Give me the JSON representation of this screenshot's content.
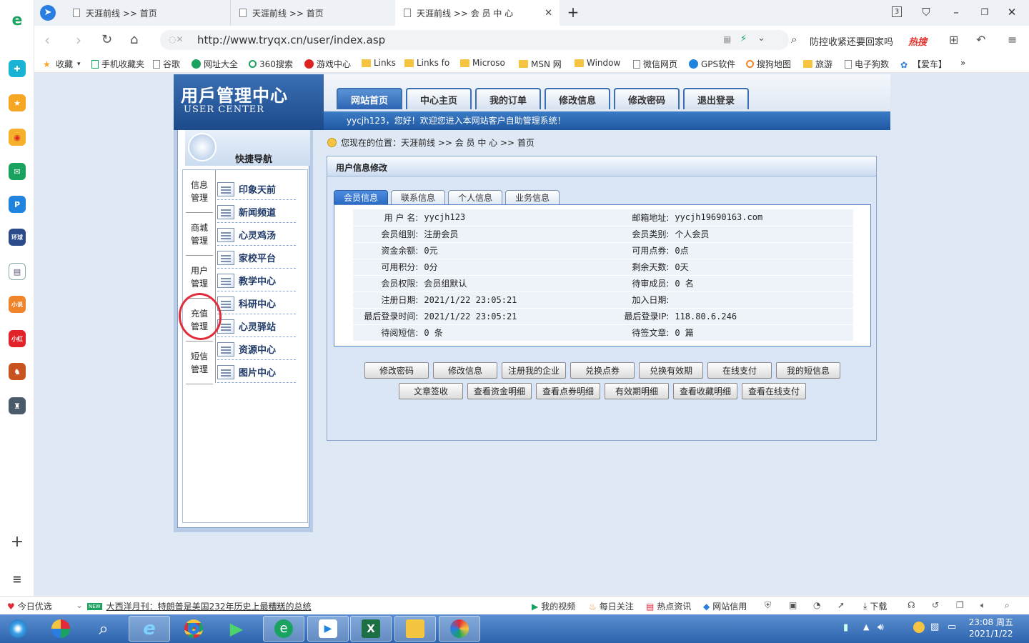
{
  "browser": {
    "tabs": [
      {
        "label": "天涯前线 >> 首页"
      },
      {
        "label": "天涯前线 >> 首页"
      },
      {
        "label": "天涯前线 >> 会 员 中 心"
      }
    ],
    "tab_count": "3",
    "url": "http://www.tryqx.cn/user/index.asp",
    "search_placeholder": "防控收紧还要回家吗",
    "search_hot": "热搜",
    "bookmarks": [
      "收藏",
      "手机收藏夹",
      "谷歌",
      "网址大全",
      "360搜索",
      "游戏中心",
      "Links",
      "Links fo",
      "Microso",
      "MSN 网",
      "Window",
      "微信网页",
      "GPS软件",
      "搜狗地图",
      "旅游",
      "电子狗数",
      "【爱车】",
      "»"
    ]
  },
  "site": {
    "logo_cn": "用戶管理中心",
    "logo_en": "USER CENTER",
    "nav": [
      "网站首页",
      "中心主页",
      "我的订单",
      "修改信息",
      "修改密码",
      "退出登录"
    ],
    "welcome": "yycjh123，您好！欢迎您进入本网站客户自助管理系统！",
    "quick_nav_title": "快捷导航",
    "categories": [
      "信息\n管理",
      "商城\n管理",
      "用户\n管理",
      "充值\n管理",
      "短信\n管理"
    ],
    "nav_items": [
      "印象天前",
      "新闻频道",
      "心灵鸡汤",
      "家校平台",
      "教学中心",
      "科研中心",
      "心灵驿站",
      "资源中心",
      "图片中心"
    ],
    "breadcrumb": "您现在的位置：天涯前线 >> 会 员 中 心 >> 首页",
    "panel_title": "用户信息修改",
    "sub_tabs": [
      "会员信息",
      "联系信息",
      "个人信息",
      "业务信息"
    ],
    "info_rows": [
      {
        "l1": "用 户 名:",
        "v1": "yycjh123",
        "l2": "邮箱地址:",
        "v2": "yycjh19690163.com"
      },
      {
        "l1": "会员组别:",
        "v1": "注册会员",
        "l2": "会员类别:",
        "v2": "个人会员"
      },
      {
        "l1": "资金余额:",
        "v1": "0元",
        "l2": "可用点券:",
        "v2": "0点"
      },
      {
        "l1": "可用积分:",
        "v1": "0分",
        "l2": "剩余天数:",
        "v2": "0天"
      },
      {
        "l1": "会员权限:",
        "v1": "会员组默认",
        "l2": "待审成员:",
        "v2": "0 名"
      },
      {
        "l1": "注册日期:",
        "v1": "2021/1/22 23:05:21",
        "l2": "加入日期:",
        "v2": ""
      },
      {
        "l1": "最后登录时间:",
        "v1": "2021/1/22 23:05:21",
        "l2": "最后登录IP:",
        "v2": "118.80.6.246"
      },
      {
        "l1": "待阅短信:",
        "v1": "0 条",
        "l2": "待签文章:",
        "v2": "0 篇"
      }
    ],
    "buttons_row1": [
      "修改密码",
      "修改信息",
      "注册我的企业",
      "兑换点券",
      "兑换有效期",
      "在线支付",
      "我的短信息"
    ],
    "buttons_row2": [
      "文章签收",
      "查看资金明细",
      "查看点券明细",
      "有效期明细",
      "查看收藏明细",
      "查看在线支付"
    ]
  },
  "statusbar": {
    "left": "今日优选",
    "news_badge": "NEW",
    "news": "大西洋月刊：特朗普是美国232年历史上最糟糕的总统",
    "items": [
      "我的视频",
      "每日关注",
      "热点资讯",
      "网站信用",
      "下载"
    ]
  },
  "clock": {
    "time": "23:08 周五",
    "date": "2021/1/22"
  },
  "colors": {
    "accent": "#1b4f93",
    "highlight_circle": "#e22b3a"
  }
}
